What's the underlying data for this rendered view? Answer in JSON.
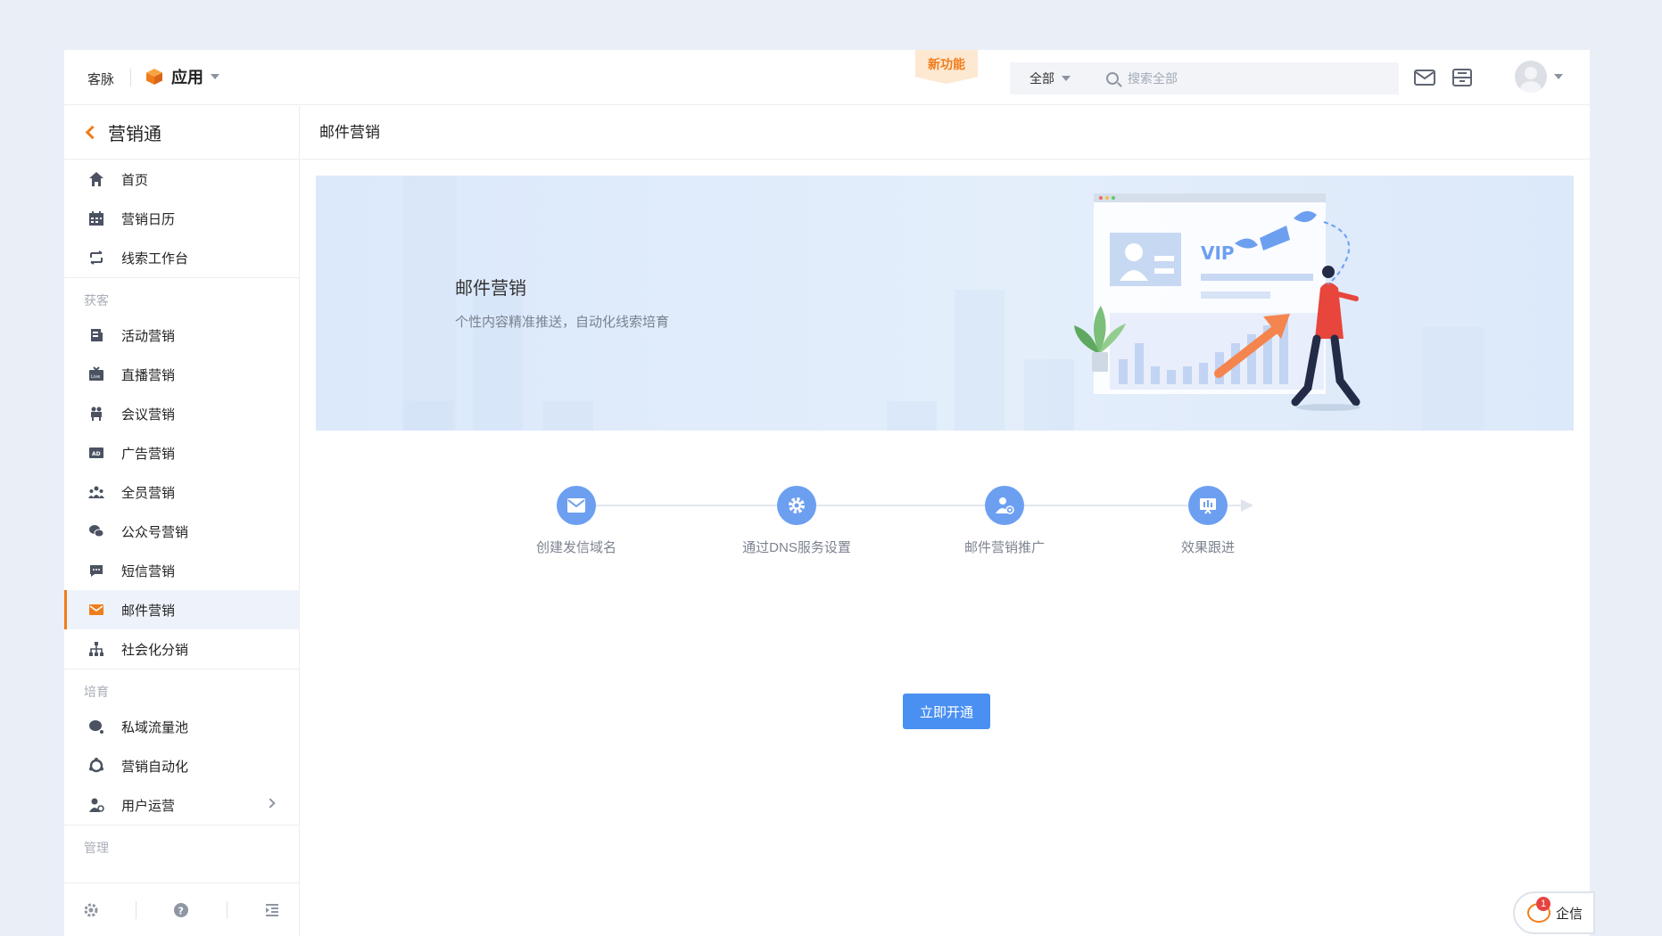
{
  "topbar": {
    "brand": "客脉",
    "app_label": "应用",
    "new_feature": "新功能",
    "search_scope": "全部",
    "search_placeholder": "搜索全部"
  },
  "sidebar": {
    "title": "营销通",
    "top_items": [
      {
        "label": "首页",
        "icon": "home-icon"
      },
      {
        "label": "营销日历",
        "icon": "calendar-icon"
      },
      {
        "label": "线索工作台",
        "icon": "leads-workbench-icon"
      }
    ],
    "group_acquire": "获客",
    "acquire_items": [
      {
        "label": "活动营销",
        "icon": "activity-icon"
      },
      {
        "label": "直播营销",
        "icon": "live-icon"
      },
      {
        "label": "会议营销",
        "icon": "meeting-icon"
      },
      {
        "label": "广告营销",
        "icon": "ad-icon"
      },
      {
        "label": "全员营销",
        "icon": "all-staff-icon"
      },
      {
        "label": "公众号营销",
        "icon": "wechat-icon"
      },
      {
        "label": "短信营销",
        "icon": "sms-icon"
      },
      {
        "label": "邮件营销",
        "icon": "mail-icon",
        "active": true
      },
      {
        "label": "社会化分销",
        "icon": "distribution-icon"
      }
    ],
    "group_nurture": "培育",
    "nurture_items": [
      {
        "label": "私域流量池",
        "icon": "private-traffic-icon"
      },
      {
        "label": "营销自动化",
        "icon": "automation-icon"
      },
      {
        "label": "用户运营",
        "icon": "user-ops-icon",
        "has_children": true
      }
    ],
    "group_manage": "管理"
  },
  "main": {
    "page_title": "邮件营销",
    "banner": {
      "title": "邮件营销",
      "subtitle": "个性内容精准推送，自动化线索培育",
      "vip_text": "VIP"
    },
    "steps": [
      {
        "label": "创建发信域名",
        "icon": "mail-icon"
      },
      {
        "label": "通过DNS服务设置",
        "icon": "gear-icon"
      },
      {
        "label": "邮件营销推广",
        "icon": "user-promo-icon"
      },
      {
        "label": "效果跟进",
        "icon": "monitor-chart-icon"
      }
    ],
    "open_button": "立即开通"
  },
  "qixin": {
    "label": "企信",
    "badge": "1"
  },
  "colors": {
    "accent": "#f07d1b",
    "primary": "#4a90f2",
    "step_circle": "#6d9ff1"
  }
}
